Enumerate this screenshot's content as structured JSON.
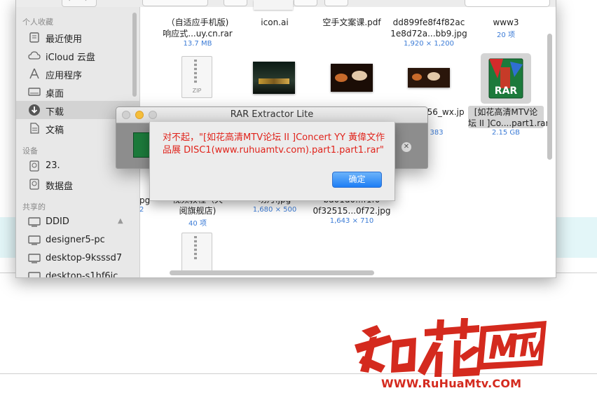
{
  "sidebar": {
    "sections": [
      {
        "title": "个人收藏"
      },
      {
        "title": "设备"
      },
      {
        "title": "共享的"
      }
    ],
    "favorites": [
      {
        "label": "最近使用",
        "icon": "recents-icon"
      },
      {
        "label": "iCloud 云盘",
        "icon": "icloud-icon"
      },
      {
        "label": "应用程序",
        "icon": "applications-icon"
      },
      {
        "label": "桌面",
        "icon": "desktop-icon"
      },
      {
        "label": "下载",
        "icon": "downloads-icon",
        "selected": true
      },
      {
        "label": "文稿",
        "icon": "documents-icon"
      }
    ],
    "devices": [
      {
        "label": "23.",
        "icon": "disk-icon"
      },
      {
        "label": "数据盘",
        "icon": "disk-icon"
      }
    ],
    "shared": [
      {
        "label": "DDID",
        "icon": "computer-icon"
      },
      {
        "label": "designer5-pc",
        "icon": "computer-icon"
      },
      {
        "label": "desktop-9ksssd7",
        "icon": "computer-icon"
      },
      {
        "label": "desktop-s1hf6ic",
        "icon": "computer-icon"
      }
    ]
  },
  "files": {
    "row1": [
      {
        "name1": "（自适应手机版)",
        "name2": "响应式...uy.cn.rar",
        "meta": "13.7 MB"
      },
      {
        "name1": "icon.ai",
        "name2": "",
        "meta": ""
      },
      {
        "name1": "空手文案课.pdf",
        "name2": "",
        "meta": ""
      },
      {
        "name1": "dd899fe8f4f82ac",
        "name2": "1e8d72a...bb9.jpg",
        "meta": "1,920 × 1,200"
      },
      {
        "name1": "www3",
        "name2": "",
        "meta": "20 项"
      }
    ],
    "row2": [
      {
        "name1": "356_wx.jp",
        "name2": "g",
        "meta": "× 383"
      },
      {
        "name1": "[如花高清MTV论",
        "name2": "坛 II ]Co....part1.rar",
        "meta": "2.15 GB"
      }
    ],
    "row3": [
      {
        "name1": "pg",
        "name2": "",
        "meta": "2"
      },
      {
        "name1": "视频教程（天",
        "name2": "阅旗舰店)",
        "meta": "40 项"
      },
      {
        "name1": "功月.jpg",
        "name2": "",
        "meta": "1,680 × 500"
      },
      {
        "name1": "ba01d0...f1f0",
        "name2": "0f32515...0f72.jpg",
        "meta": "1,643 × 710"
      }
    ],
    "zip_label": "ZIP",
    "rar_label": "RAR"
  },
  "rar_window": {
    "title": "RAR Extractor Lite"
  },
  "alert": {
    "message": "对不起，\"[如花高清MTV论坛 II ]Concert YY 黃偉文作品展 DISC1(www.ruhuamtv.com).part1.part1.rar\"",
    "ok_label": "确定"
  },
  "logo": {
    "url": "WWW.RuHuaMtv.COM"
  },
  "colors": {
    "alert_text": "#e0231b",
    "accent": "#1d7ef5",
    "meta_text": "#3b7bd6",
    "logo_red": "#d42a1e"
  }
}
